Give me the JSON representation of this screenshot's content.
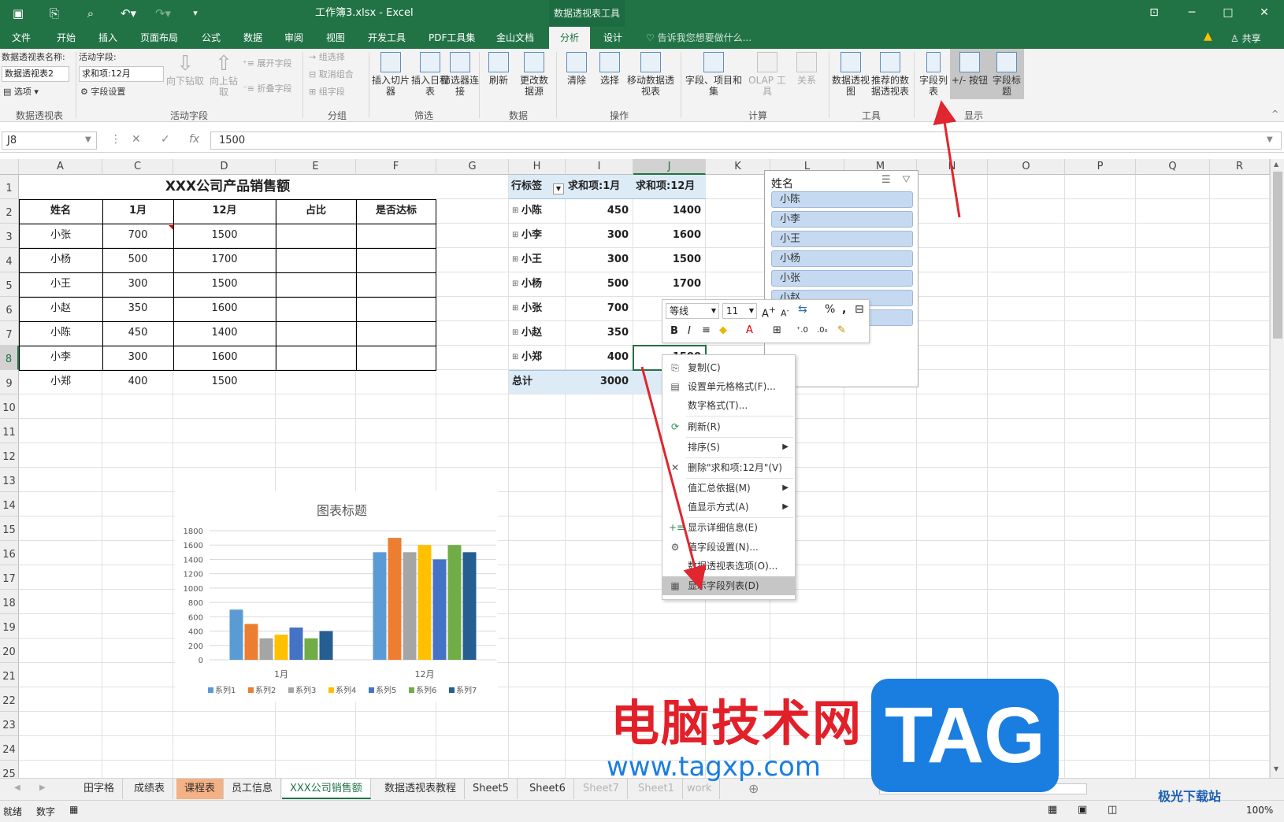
{
  "window": {
    "title": "工作簿3.xlsx - Excel",
    "context_tab": "数据透视表工具",
    "qat_icons": [
      "save-icon",
      "save-as-icon",
      "print-preview-icon",
      "undo-icon",
      "redo-icon",
      "customize-icon"
    ]
  },
  "menu": {
    "tabs": [
      "文件",
      "开始",
      "插入",
      "页面布局",
      "公式",
      "数据",
      "审阅",
      "视图",
      "开发工具",
      "PDF工具集",
      "金山文档",
      "分析",
      "设计"
    ],
    "active_tab": "分析",
    "tell_me": "告诉我您想要做什么...",
    "share": "共享"
  },
  "ribbon": {
    "pt_name_label": "数据透视表名称:",
    "pt_name_value": "数据透视表2",
    "options_label": "选项",
    "active_field_label": "活动字段:",
    "active_field_value": "求和项:12月",
    "field_settings": "字段设置",
    "drill_down": "向下钻取",
    "drill_up": "向上钻取",
    "expand_field": "展开字段",
    "collapse_field": "折叠字段",
    "group_selection": "组选择",
    "ungroup": "取消组合",
    "group_field": "组字段",
    "insert_slicer": "插入切片器",
    "insert_timeline": "插入日程表",
    "filter_connections": "筛选器连接",
    "refresh": "刷新",
    "change_source": "更改数据源",
    "clear": "清除",
    "select": "选择",
    "move_pt": "移动数据透视表",
    "fields_items": "字段、项目和集",
    "olap_tools": "OLAP 工具",
    "relationships": "关系",
    "pivot_chart": "数据透视图",
    "recommended_pt": "推荐的数据透视表",
    "field_list": "字段列表",
    "plus_minus": "+/- 按钮",
    "field_headers": "字段标题",
    "groups": [
      "数据透视表",
      "活动字段",
      "分组",
      "筛选",
      "数据",
      "操作",
      "计算",
      "工具",
      "显示"
    ]
  },
  "formula_bar": {
    "name_box": "J8",
    "value": "1500",
    "cancel": "✕",
    "enter": "✓",
    "fx": "fx"
  },
  "columns": [
    "A",
    "C",
    "D",
    "E",
    "F",
    "G",
    "H",
    "I",
    "J",
    "K",
    "L",
    "M",
    "N",
    "O",
    "P",
    "Q",
    "R"
  ],
  "rows": [
    "1",
    "2",
    "3",
    "4",
    "5",
    "6",
    "7",
    "8",
    "9",
    "10",
    "11",
    "12",
    "13",
    "14",
    "15",
    "16",
    "17",
    "18",
    "19",
    "20",
    "21",
    "22",
    "23",
    "24",
    "25"
  ],
  "table": {
    "title": "XXX公司产品销售额",
    "headers": [
      "姓名",
      "1月",
      "12月",
      "占比",
      "是否达标"
    ],
    "rows": [
      [
        "小张",
        "700",
        "1500"
      ],
      [
        "小杨",
        "500",
        "1700"
      ],
      [
        "小王",
        "300",
        "1500"
      ],
      [
        "小赵",
        "350",
        "1600"
      ],
      [
        "小陈",
        "450",
        "1400"
      ],
      [
        "小李",
        "300",
        "1600"
      ],
      [
        "小郑",
        "400",
        "1500"
      ]
    ]
  },
  "pivot": {
    "headers": [
      "行标签",
      "求和项:1月",
      "求和项:12月"
    ],
    "rows": [
      [
        "小陈",
        "450",
        "1400"
      ],
      [
        "小李",
        "300",
        "1600"
      ],
      [
        "小王",
        "300",
        "1500"
      ],
      [
        "小杨",
        "500",
        "1700"
      ],
      [
        "小张",
        "700",
        ""
      ],
      [
        "小赵",
        "350",
        ""
      ],
      [
        "小郑",
        "400",
        "1500"
      ]
    ],
    "total_label": "总计",
    "total_jan": "3000"
  },
  "field_pane": {
    "title": "姓名",
    "items": [
      "小陈",
      "小李",
      "小王",
      "小杨",
      "小张",
      "小赵",
      "小郑"
    ]
  },
  "mini_toolbar": {
    "font": "等线",
    "size": "11",
    "icons": [
      "grow-font-icon",
      "shrink-font-icon",
      "format-icon",
      "percent-icon",
      "comma-icon",
      "table-icon",
      "bold-icon",
      "italic-icon",
      "align-icon",
      "fill-color-icon",
      "font-color-icon",
      "borders-icon",
      "increase-decimal-icon",
      "decrease-decimal-icon",
      "format-painter-icon"
    ]
  },
  "context_menu": {
    "items": [
      {
        "label": "复制(C)",
        "icon": "copy-icon"
      },
      {
        "label": "设置单元格格式(F)...",
        "icon": "format-cells-icon"
      },
      {
        "label": "数字格式(T)...",
        "icon": ""
      },
      {
        "label": "刷新(R)",
        "icon": "refresh-icon"
      },
      {
        "label": "排序(S)",
        "icon": "",
        "submenu": true
      },
      {
        "label": "删除\"求和项:12月\"(V)",
        "icon": "delete-icon"
      },
      {
        "label": "值汇总依据(M)",
        "icon": "",
        "submenu": true
      },
      {
        "label": "值显示方式(A)",
        "icon": "",
        "submenu": true
      },
      {
        "label": "显示详细信息(E)",
        "icon": "show-detail-icon"
      },
      {
        "label": "值字段设置(N)...",
        "icon": "field-settings-icon"
      },
      {
        "label": "数据透视表选项(O)...",
        "icon": ""
      },
      {
        "label": "显示字段列表(D)",
        "icon": "field-list-icon",
        "highlighted": true
      }
    ]
  },
  "chart_data": {
    "type": "bar",
    "title": "图表标题",
    "categories": [
      "1月",
      "12月"
    ],
    "ylim": [
      0,
      1800
    ],
    "yticks": [
      "0",
      "200",
      "400",
      "600",
      "800",
      "1000",
      "1200",
      "1400",
      "1600",
      "1800"
    ],
    "series": [
      {
        "name": "系列1",
        "values": [
          700,
          1500
        ],
        "color": "#5b9bd5"
      },
      {
        "name": "系列2",
        "values": [
          500,
          1700
        ],
        "color": "#ed7d31"
      },
      {
        "name": "系列3",
        "values": [
          300,
          1500
        ],
        "color": "#a5a5a5"
      },
      {
        "name": "系列4",
        "values": [
          350,
          1600
        ],
        "color": "#ffc000"
      },
      {
        "name": "系列5",
        "values": [
          450,
          1400
        ],
        "color": "#4472c4"
      },
      {
        "name": "系列6",
        "values": [
          300,
          1600
        ],
        "color": "#70ad47"
      },
      {
        "name": "系列7",
        "values": [
          400,
          1500
        ],
        "color": "#255e91"
      }
    ],
    "legend": "bottom",
    "grid": true
  },
  "sheet_tabs": {
    "tabs": [
      "田字格",
      "成绩表",
      "课程表",
      "员工信息",
      "XXX公司销售额",
      "数据透视表教程",
      "Sheet5",
      "Sheet6",
      "Sheet7",
      "Sheet1",
      "work"
    ],
    "active": "XXX公司销售额",
    "orange": "课程表"
  },
  "status": {
    "ready": "就绪",
    "mode": "数字",
    "zoom": "100%"
  },
  "watermark": {
    "cn": "电脑技术网",
    "tag": "TAG",
    "url": "www.tagxp.com",
    "corner": "极光下载站"
  },
  "colors": {
    "excel_green": "#217346",
    "pivot_header": "#ddebf7",
    "annotation_red": "#e0262e"
  }
}
